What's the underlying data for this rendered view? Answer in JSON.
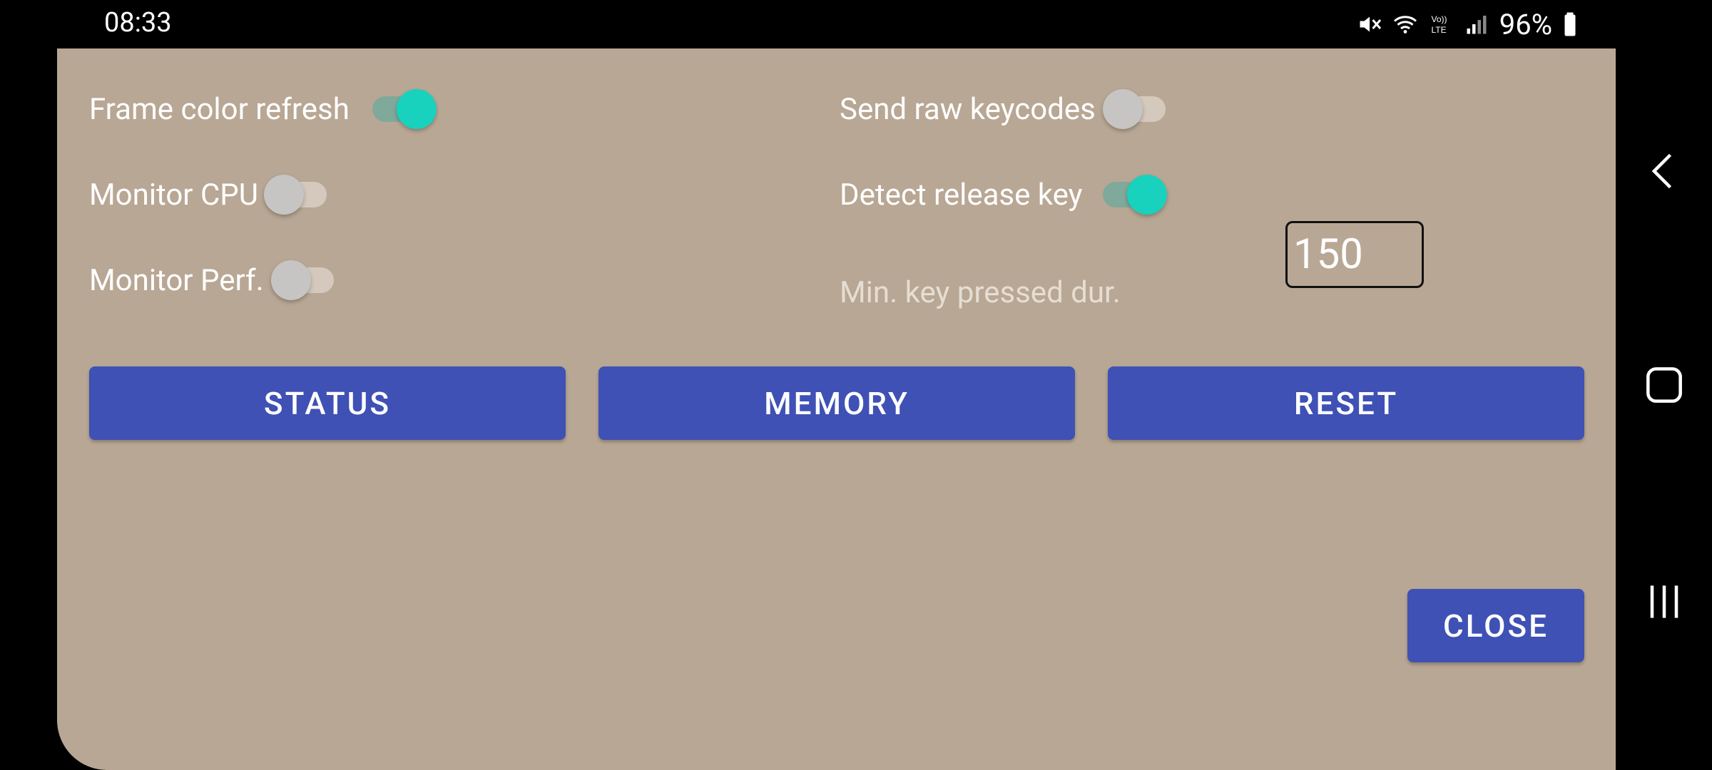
{
  "status_bar": {
    "time": "08:33",
    "battery_percent": "96%",
    "icons": [
      "mute-icon",
      "wifi-icon",
      "volte-icon",
      "signal-icon",
      "battery-icon"
    ]
  },
  "settings": {
    "frame_color_refresh": {
      "label": "Frame color refresh",
      "on": true
    },
    "monitor_cpu": {
      "label": "Monitor CPU",
      "on": false
    },
    "monitor_perf": {
      "label": "Monitor Perf.",
      "on": false
    },
    "send_raw_keycodes": {
      "label": "Send raw keycodes",
      "on": false
    },
    "detect_release_key": {
      "label": "Detect release key",
      "on": true
    },
    "min_key_pressed_dur": {
      "label": "Min. key pressed dur.",
      "value": "150"
    }
  },
  "buttons": {
    "status": "STATUS",
    "memory": "MEMORY",
    "reset": "RESET",
    "close": "CLOSE"
  },
  "colors": {
    "panel_bg": "#b8a794",
    "button_bg": "#3f51b5",
    "switch_on": "#18d2bd"
  },
  "navigation": [
    "back-icon",
    "home-icon",
    "recents-icon"
  ]
}
